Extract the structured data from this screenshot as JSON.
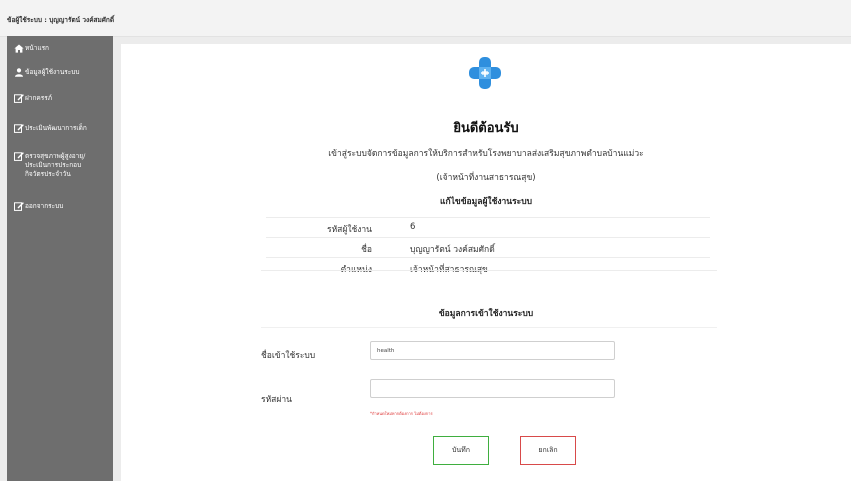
{
  "header": {
    "user_label": "ข้อผู้ใช้ระบบ : บุญญารัตน์ วงค์สมศักดิ์"
  },
  "sidebar": {
    "items": [
      {
        "label": "หน้าแรก",
        "icon": "home-icon"
      },
      {
        "label": "ข้อมูลผู้ใช้งานระบบ",
        "icon": "user-icon"
      },
      {
        "label": "ฝากครรภ์",
        "icon": "edit-icon"
      },
      {
        "label": "ประเมินพัฒนาการเด็ก",
        "icon": "edit-icon"
      },
      {
        "label": "ตรวจสุขภาพผู้สูงอายุ/\nประเมินการประกอบ\nกิจวัตรประจำวัน",
        "icon": "edit-icon"
      },
      {
        "label": "ออกจากระบบ",
        "icon": "edit-icon"
      }
    ]
  },
  "main": {
    "welcome": "ยินดีต้อนรับ",
    "description": "เข้าสู่ระบบจัดการข้อมูลการให้บริการสำหรับโรงพยาบาลส่งเสริมสุขภาพตำบลบ้านแม่วะ",
    "role": "(เจ้าหน้าที่งานสาธารณสุข)",
    "edit_title": "แก้ไขข้อมูลผู้ใช้งานระบบ",
    "info": [
      {
        "key": "รหัสผู้ใช้งาน",
        "value": "6"
      },
      {
        "key": "ชื่อ",
        "value": "บุญญารัตน์  วงค์สมศักดิ์"
      },
      {
        "key": "ตำแหน่ง",
        "value": "เจ้าหน้าที่สาธารณสุข"
      }
    ],
    "login_title": "ข้อมูลการเข้าใช้งานระบบ",
    "username_label": "ชื่อเข้าใช้ระบบ",
    "username_value": "health",
    "password_label": "รหัสผ่าน",
    "password_value": "",
    "password_hint": "*กำหนดใหม่หากต้องการ ไม่ต้องการ",
    "save_label": "บันทึก",
    "cancel_label": "ยกเลิก"
  },
  "colors": {
    "sidebar": "#6e6e6e",
    "logo": "#2f8fde",
    "save_border": "#3fae3f",
    "cancel_border": "#d84a4a"
  }
}
